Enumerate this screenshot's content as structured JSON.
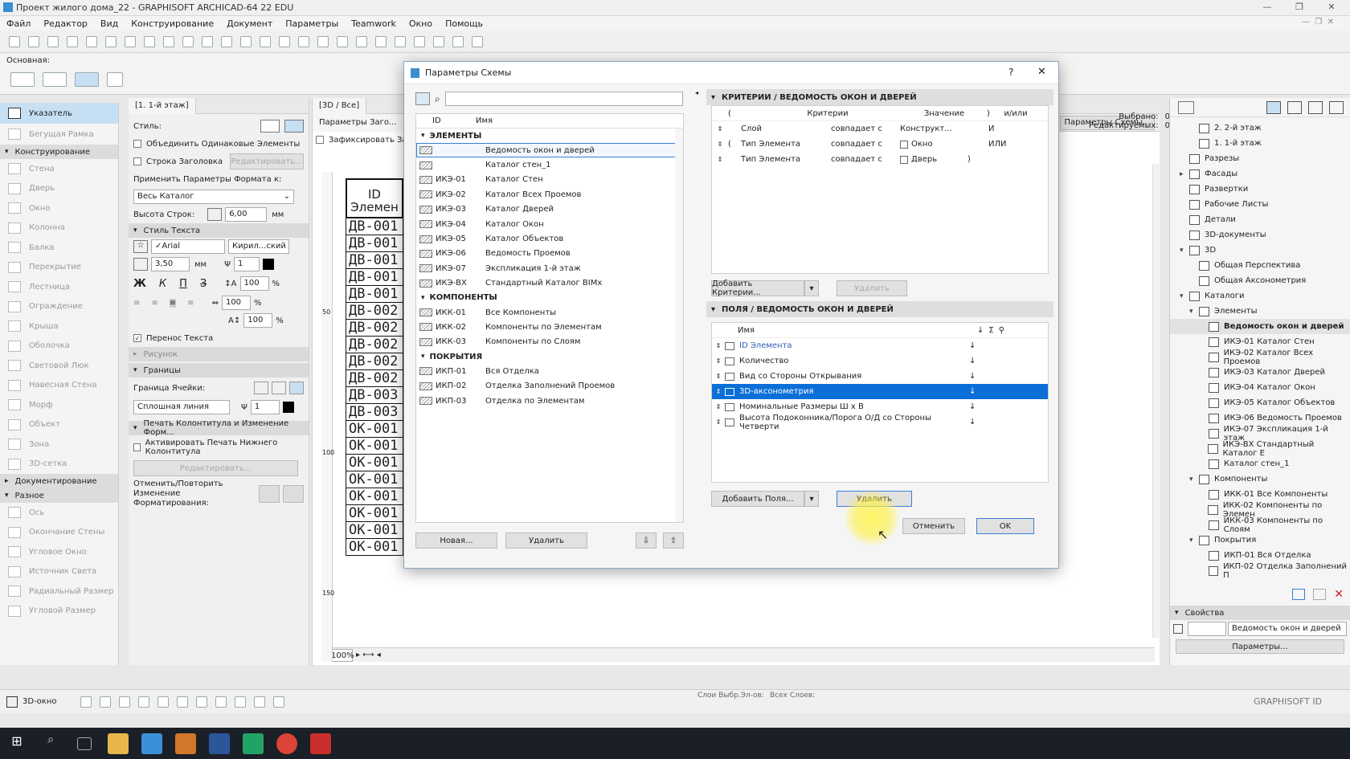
{
  "window": {
    "title": "Проект жилого дома_22 - GRAPHISOFT ARCHICAD-64 22 EDU"
  },
  "menu": [
    "Файл",
    "Редактор",
    "Вид",
    "Конструирование",
    "Документ",
    "Параметры",
    "Teamwork",
    "Окно",
    "Помощь"
  ],
  "infobox": {
    "label": "Основная:"
  },
  "toolbox": {
    "pointer": "Указатель",
    "marquee": "Бегущая Рамка",
    "sec_construct": "Конструирование",
    "construct_items": [
      "Стена",
      "Дверь",
      "Окно",
      "Колонна",
      "Балка",
      "Перекрытие",
      "Лестница",
      "Ограждение",
      "Крыша",
      "Оболочка",
      "Световой Люк",
      "Навесная Стена",
      "Морф",
      "Объект",
      "Зона",
      "3D-сетка"
    ],
    "sec_doc": "Документирование",
    "sec_misc": "Разное",
    "misc_items": [
      "Ось",
      "Окончание Стены",
      "Угловое Окно",
      "Источник Света",
      "Радиальный Размер",
      "Угловой Размер"
    ]
  },
  "settings": {
    "tab": "[1. 1-й этаж]",
    "style_label": "Стиль:",
    "merge": "Объединить Одинаковые Элементы",
    "header_row": "Строка Заголовка",
    "edit_btn": "Редактировать...",
    "apply_label": "Применить Параметры Формата к:",
    "apply_value": "Весь Каталог",
    "row_height_label": "Высота Строк:",
    "row_height_value": "6,00",
    "unit_mm": "мм",
    "text_style": "Стиль Текста",
    "font": "Arial",
    "charset": "Кирил...ский",
    "size": "3,50",
    "pen": "1",
    "pct1": "100",
    "pct2": "100",
    "pct3": "100",
    "pct_sign": "%",
    "bold": "Ж",
    "italic": "К",
    "underline": "П",
    "strike": "З",
    "wrap": "Перенос Текста",
    "drawing": "Рисунок",
    "borders": "Границы",
    "cell_border": "Граница Ячейки:",
    "line_type": "Сплошная линия",
    "line_pen": "1",
    "print_header": "Печать Колонтитула и Изменение Форм...",
    "print_footer": "Активировать Печать Нижнего Колонтитула",
    "edit_btn2": "Редактировать...",
    "undo_label": "Отменить/Повторить Изменение Форматирования:"
  },
  "canvas": {
    "tab": "[3D / Все]",
    "param_tab": "Параметры Заго...",
    "lock": "Зафиксировать За",
    "schema_params": "Параметры Схемы...",
    "table_header": "ID\nЭлемен",
    "cells": [
      "ДВ-001",
      "ДВ-001",
      "ДВ-001",
      "ДВ-001",
      "ДВ-001",
      "ДВ-002",
      "ДВ-002",
      "ДВ-002",
      "ДВ-002",
      "ДВ-002",
      "ДВ-003",
      "ДВ-003",
      "ОК-001",
      "ОК-001",
      "ОК-001",
      "ОК-001",
      "ОК-001",
      "ОК-001",
      "ОК-001",
      "ОК-001"
    ],
    "zoom": "100%",
    "ruler_marks": [
      "50",
      "100",
      "150"
    ]
  },
  "selection": {
    "selected_label": "Выбрано:",
    "selected": "0",
    "editable_label": "Редактируемых:",
    "editable": "0"
  },
  "dialog": {
    "title": "Параметры Схемы",
    "help": "?",
    "close": "✕",
    "search_placeholder": "",
    "col_id": "ID",
    "col_name": "Имя",
    "groups": [
      {
        "name": "ЭЛЕМЕНТЫ",
        "items": [
          {
            "id": "",
            "name": "Ведомость окон и дверей",
            "selected": true
          },
          {
            "id": "",
            "name": "Каталог стен_1"
          },
          {
            "id": "ИКЭ-01",
            "name": "Каталог Стен"
          },
          {
            "id": "ИКЭ-02",
            "name": "Каталог Всех Проемов"
          },
          {
            "id": "ИКЭ-03",
            "name": "Каталог Дверей"
          },
          {
            "id": "ИКЭ-04",
            "name": "Каталог Окон"
          },
          {
            "id": "ИКЭ-05",
            "name": "Каталог Объектов"
          },
          {
            "id": "ИКЭ-06",
            "name": "Ведомость Проемов"
          },
          {
            "id": "ИКЭ-07",
            "name": "Экспликация 1-й этаж"
          },
          {
            "id": "ИКЭ-ВХ",
            "name": "Стандартный Каталог BIMx"
          }
        ]
      },
      {
        "name": "КОМПОНЕНТЫ",
        "items": [
          {
            "id": "ИКК-01",
            "name": "Все Компоненты"
          },
          {
            "id": "ИКК-02",
            "name": "Компоненты по Элементам"
          },
          {
            "id": "ИКК-03",
            "name": "Компоненты по Слоям"
          }
        ]
      },
      {
        "name": "ПОКРЫТИЯ",
        "items": [
          {
            "id": "ИКП-01",
            "name": "Вся Отделка"
          },
          {
            "id": "ИКП-02",
            "name": "Отделка Заполнений Проемов"
          },
          {
            "id": "ИКП-03",
            "name": "Отделка по Элементам"
          }
        ]
      }
    ],
    "new_btn": "Новая...",
    "delete_btn": "Удалить",
    "criteria_title": "КРИТЕРИИ / ВЕДОМОСТЬ ОКОН И ДВЕРЕЙ",
    "crit_head": {
      "paren": "(",
      "criteria": "Критерии",
      "value": "Значение",
      "close": ")",
      "andor": "и/или"
    },
    "criteria": [
      {
        "paren": "",
        "field": "Слой",
        "op": "совпадает с",
        "value": "Конструкт...",
        "close": "",
        "andor": "И"
      },
      {
        "paren": "(",
        "field": "Тип Элемента",
        "op": "совпадает с",
        "value": "Окно",
        "close": "",
        "andor": "ИЛИ"
      },
      {
        "paren": "",
        "field": "Тип Элемента",
        "op": "совпадает с",
        "value": "Дверь",
        "close": ")",
        "andor": ""
      }
    ],
    "add_criteria": "Добавить Критерии...",
    "delete_criteria": "Удалить",
    "fields_title": "ПОЛЯ / ВЕДОМОСТЬ ОКОН И ДВЕРЕЙ",
    "fields_head": "Имя",
    "fields": [
      {
        "name": "ID Элемента",
        "link": true
      },
      {
        "name": "Количество"
      },
      {
        "name": "Вид со Стороны Открывания"
      },
      {
        "name": "3D-аксонометрия",
        "selected": true
      },
      {
        "name": "Номинальные Размеры  Ш x В"
      },
      {
        "name": "Высота Подоконника/Порога О/Д со Стороны Четверти"
      }
    ],
    "add_fields": "Добавить Поля...",
    "delete_fields": "Удалить",
    "cancel": "Отменить",
    "ok": "OK"
  },
  "navigator": {
    "items": [
      {
        "label": "2. 2-й этаж",
        "lvl": 2
      },
      {
        "label": "1. 1-й этаж",
        "lvl": 2
      },
      {
        "label": "Разрезы",
        "lvl": 1
      },
      {
        "label": "Фасады",
        "lvl": 1,
        "arrow": "▸"
      },
      {
        "label": "Развертки",
        "lvl": 1
      },
      {
        "label": "Рабочие Листы",
        "lvl": 1
      },
      {
        "label": "Детали",
        "lvl": 1
      },
      {
        "label": "3D-документы",
        "lvl": 1
      },
      {
        "label": "3D",
        "lvl": 1,
        "arrow": "▾"
      },
      {
        "label": "Общая Перспектива",
        "lvl": 2
      },
      {
        "label": "Общая Аксонометрия",
        "lvl": 2
      },
      {
        "label": "Каталоги",
        "lvl": 1,
        "arrow": "▾"
      },
      {
        "label": "Элементы",
        "lvl": 2,
        "arrow": "▾"
      },
      {
        "label": "Ведомость окон и дверей",
        "lvl": 3,
        "sel": true
      },
      {
        "label": "ИКЭ-01 Каталог Стен",
        "lvl": 3
      },
      {
        "label": "ИКЭ-02 Каталог Всех Проемов",
        "lvl": 3
      },
      {
        "label": "ИКЭ-03 Каталог Дверей",
        "lvl": 3
      },
      {
        "label": "ИКЭ-04 Каталог Окон",
        "lvl": 3
      },
      {
        "label": "ИКЭ-05 Каталог Объектов",
        "lvl": 3
      },
      {
        "label": "ИКЭ-06 Ведомость Проемов",
        "lvl": 3
      },
      {
        "label": "ИКЭ-07 Экспликация 1-й этаж",
        "lvl": 3
      },
      {
        "label": "ИКЭ-ВХ Стандартный Каталог E",
        "lvl": 3
      },
      {
        "label": "Каталог стен_1",
        "lvl": 3
      },
      {
        "label": "Компоненты",
        "lvl": 2,
        "arrow": "▾"
      },
      {
        "label": "ИКК-01 Все Компоненты",
        "lvl": 3
      },
      {
        "label": "ИКК-02 Компоненты по Элемен",
        "lvl": 3
      },
      {
        "label": "ИКК-03 Компоненты по Слоям",
        "lvl": 3
      },
      {
        "label": "Покрытия",
        "lvl": 2,
        "arrow": "▾"
      },
      {
        "label": "ИКП-01 Вся Отделка",
        "lvl": 3
      },
      {
        "label": "ИКП-02 Отделка Заполнений П",
        "lvl": 3
      }
    ],
    "props_title": "Свойства",
    "props_value": "Ведомость окон и дверей",
    "params_btn": "Параметры..."
  },
  "bottom": {
    "view_3d": "3D-окно",
    "layers1": "Слои Выбр.Эл-ов:",
    "layers2": "Всех Слоев:",
    "brand": "GRAPHISOFT ID"
  },
  "colors": {
    "accent": "#0c6fd8",
    "title_link": "#2a5db0",
    "close_red": "#d21f1f"
  }
}
